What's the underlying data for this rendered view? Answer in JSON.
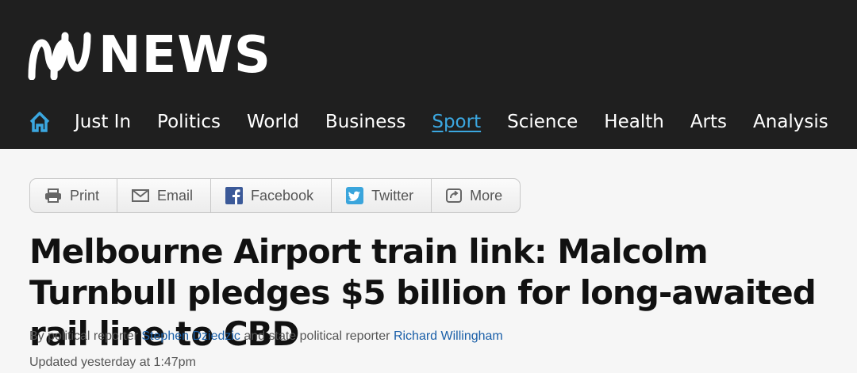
{
  "site": {
    "logo_text": "NEWS"
  },
  "nav": {
    "items": [
      {
        "label": "Just In",
        "active": false
      },
      {
        "label": "Politics",
        "active": false
      },
      {
        "label": "World",
        "active": false
      },
      {
        "label": "Business",
        "active": false
      },
      {
        "label": "Sport",
        "active": true
      },
      {
        "label": "Science",
        "active": false
      },
      {
        "label": "Health",
        "active": false
      },
      {
        "label": "Arts",
        "active": false
      },
      {
        "label": "Analysis",
        "active": false
      }
    ]
  },
  "share": {
    "print": "Print",
    "email": "Email",
    "facebook": "Facebook",
    "twitter": "Twitter",
    "more": "More"
  },
  "article": {
    "headline": "Melbourne Airport train link: Malcolm Turnbull pledges $5 billion for long-awaited rail line to CBD",
    "byline_prefix": "By political reporter",
    "author1": "Stephen Dziedzic",
    "byline_mid": "and state political reporter",
    "author2": "Richard Willingham",
    "updated": "Updated yesterday at 1:47pm"
  },
  "colors": {
    "header_bg": "#1f1f1f",
    "accent": "#3ba7e0",
    "link": "#1a5fa8",
    "facebook": "#3b5998",
    "twitter": "#3aa5dc"
  }
}
